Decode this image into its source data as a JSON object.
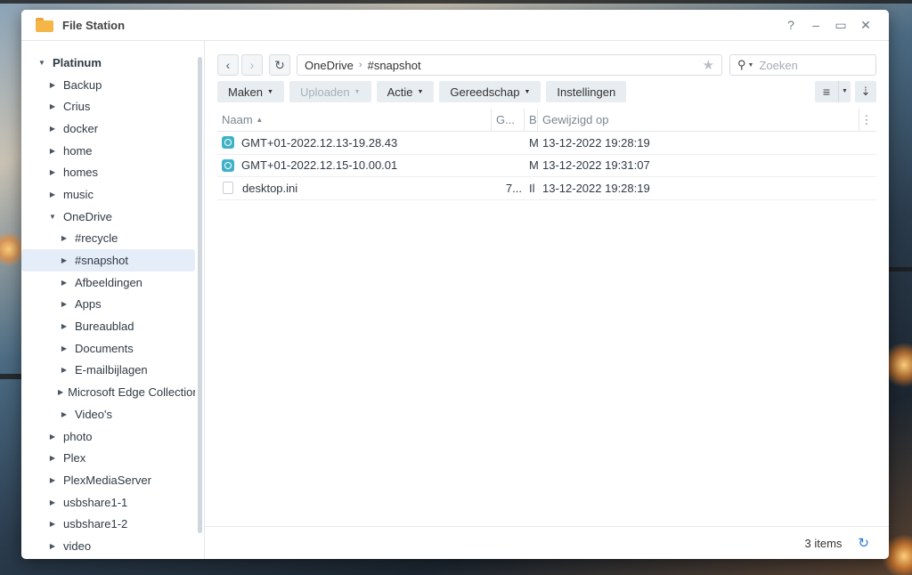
{
  "window": {
    "title": "File Station",
    "help": "?",
    "minimize": "–",
    "maximize": "▭",
    "close": "✕"
  },
  "sidebar": {
    "items": [
      {
        "label": "Platinum",
        "level": 0,
        "expanded": true
      },
      {
        "label": "Backup",
        "level": 1
      },
      {
        "label": "Crius",
        "level": 1
      },
      {
        "label": "docker",
        "level": 1
      },
      {
        "label": "home",
        "level": 1
      },
      {
        "label": "homes",
        "level": 1
      },
      {
        "label": "music",
        "level": 1
      },
      {
        "label": "OneDrive",
        "level": 1,
        "expanded": true
      },
      {
        "label": "#recycle",
        "level": 2
      },
      {
        "label": "#snapshot",
        "level": 2,
        "selected": true
      },
      {
        "label": "Afbeeldingen",
        "level": 2
      },
      {
        "label": "Apps",
        "level": 2
      },
      {
        "label": "Bureaublad",
        "level": 2
      },
      {
        "label": "Documents",
        "level": 2
      },
      {
        "label": "E-mailbijlagen",
        "level": 2
      },
      {
        "label": "Microsoft Edge Collections",
        "level": 2
      },
      {
        "label": "Video's",
        "level": 2
      },
      {
        "label": "photo",
        "level": 1
      },
      {
        "label": "Plex",
        "level": 1
      },
      {
        "label": "PlexMediaServer",
        "level": 1
      },
      {
        "label": "usbshare1-1",
        "level": 1
      },
      {
        "label": "usbshare1-2",
        "level": 1
      },
      {
        "label": "video",
        "level": 1
      }
    ]
  },
  "nav": {
    "back_icon": "chevron-left-icon",
    "forward_icon": "chevron-right-icon",
    "refresh_icon": "refresh-icon",
    "path": [
      "OneDrive",
      "#snapshot"
    ],
    "search_placeholder": "Zoeken"
  },
  "toolbar": {
    "create": "Maken",
    "upload": "Uploaden",
    "action": "Actie",
    "tools": "Gereedschap",
    "settings": "Instellingen"
  },
  "table": {
    "columns": [
      "Naam",
      "G...",
      "B",
      "Gewijzigd op"
    ],
    "rows": [
      {
        "icon": "snapshot-icon",
        "name": "GMT+01-2022.12.13-19.28.43",
        "size": "",
        "type": "M",
        "modified": "13-12-2022 19:28:19"
      },
      {
        "icon": "snapshot-icon",
        "name": "GMT+01-2022.12.15-10.00.01",
        "size": "",
        "type": "M",
        "modified": "13-12-2022 19:31:07"
      },
      {
        "icon": "file-icon",
        "name": "desktop.ini",
        "size": "7...",
        "type": "Il",
        "modified": "13-12-2022 19:28:19"
      }
    ]
  },
  "footer": {
    "count": "3 items"
  }
}
